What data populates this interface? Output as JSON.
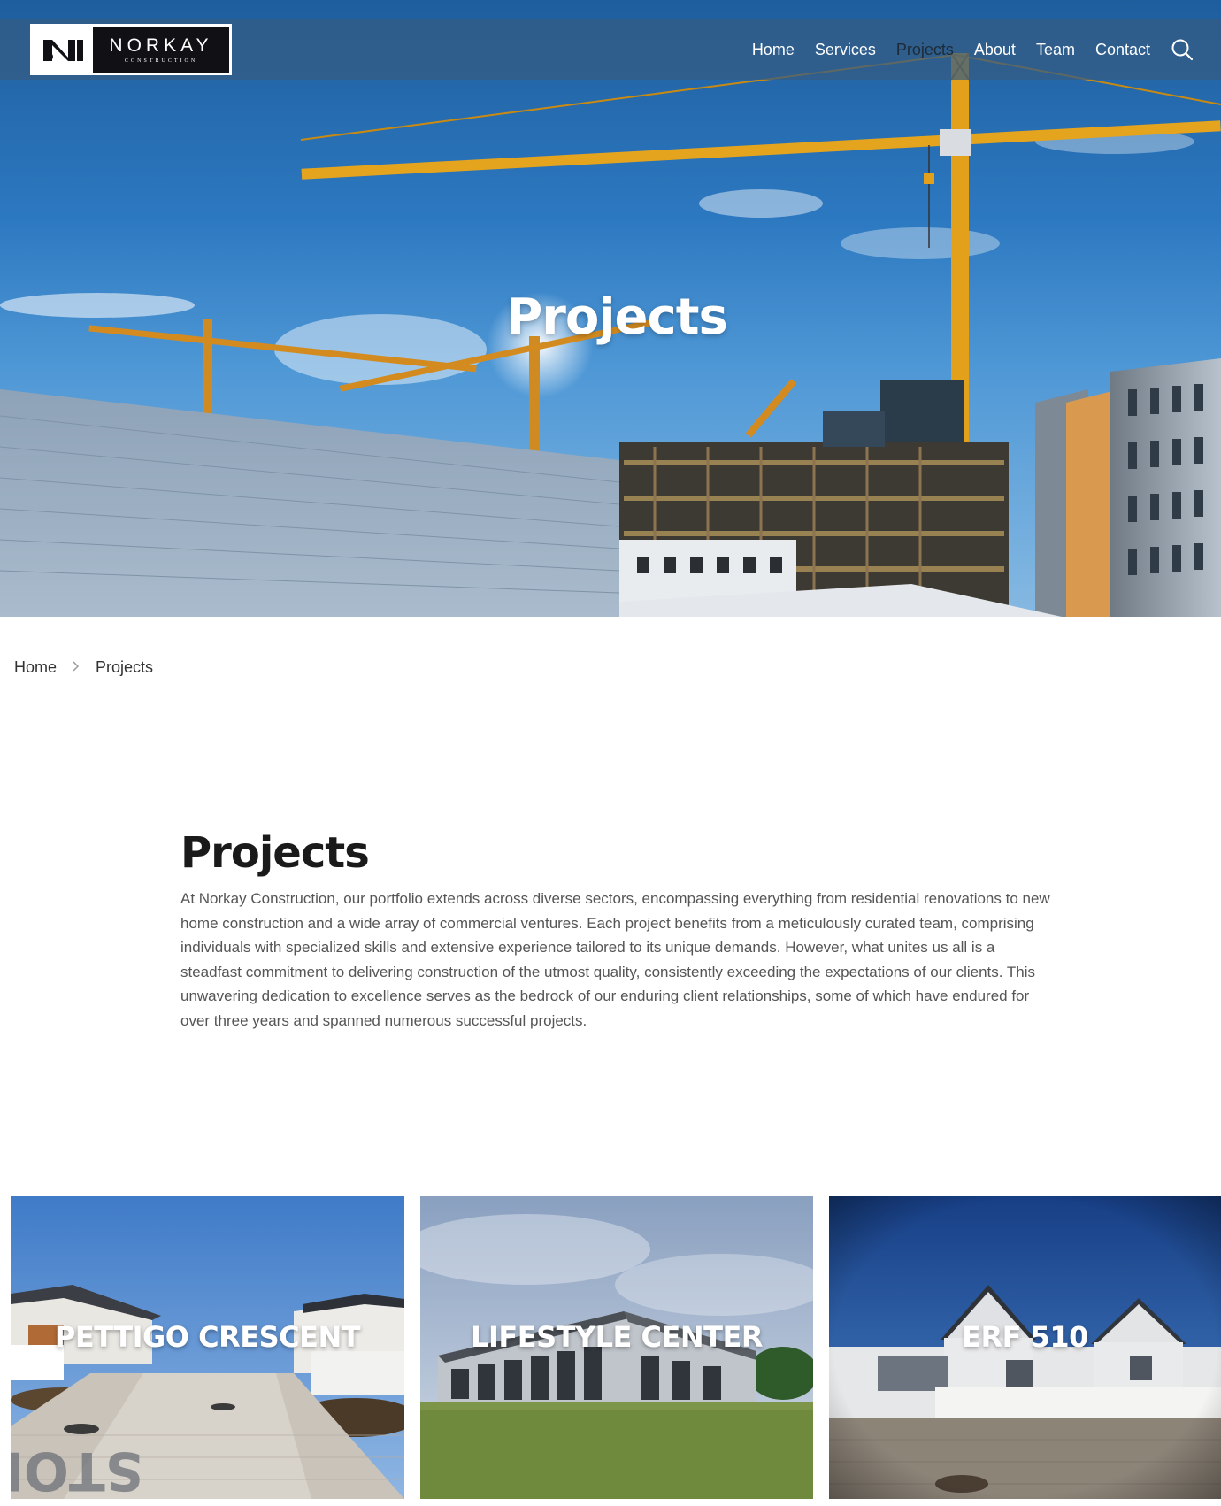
{
  "header": {
    "logo": {
      "name": "NORKAY",
      "subtitle": "CONSTRUCTION"
    },
    "nav": [
      {
        "label": "Home"
      },
      {
        "label": "Services"
      },
      {
        "label": "Projects",
        "active": true
      },
      {
        "label": "About"
      },
      {
        "label": "Team"
      },
      {
        "label": "Contact"
      }
    ],
    "search_icon": "search-icon"
  },
  "hero": {
    "title": "Projects"
  },
  "breadcrumb": {
    "items": [
      "Home",
      "Projects"
    ],
    "separator_icon": "chevron-right-icon"
  },
  "intro": {
    "heading": "Projects",
    "body": "At Norkay Construction, our portfolio extends across diverse sectors, encompassing everything from residential renovations to new home construction and a wide array of commercial ventures. Each project benefits from a meticulously curated team, comprising individuals with specialized skills and extensive experience tailored to its unique demands. However, what unites us all is a steadfast commitment to delivering construction of the utmost quality, consistently exceeding the expectations of our clients. This unwavering dedication to excellence serves as the bedrock of our enduring client relationships, some of which have endured for over three years and spanned numerous successful projects."
  },
  "projects": [
    {
      "title": "PETTIGO CRESCENT"
    },
    {
      "title": "LIFESTYLE CENTER"
    },
    {
      "title": "ERF 510"
    }
  ],
  "colors": {
    "nav_active": "#1d2b38",
    "topbar": "#345c82",
    "text_body": "#555555"
  }
}
